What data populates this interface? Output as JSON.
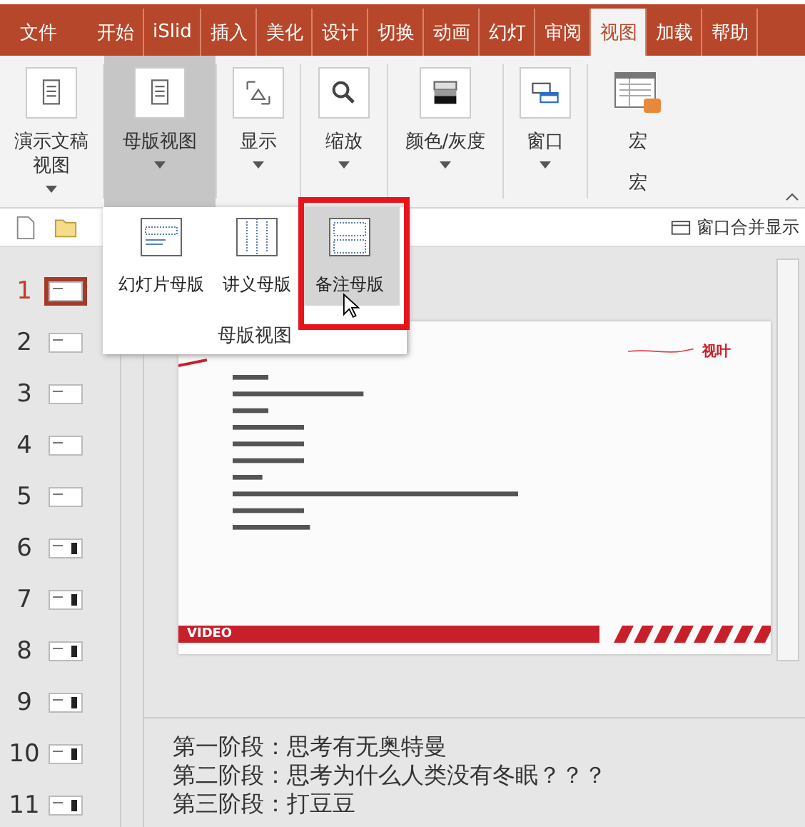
{
  "tabs": [
    {
      "label": "文件",
      "selected": false
    },
    {
      "label": "开始",
      "selected": false
    },
    {
      "label": "iSlid",
      "selected": false
    },
    {
      "label": "插入",
      "selected": false
    },
    {
      "label": "美化",
      "selected": false
    },
    {
      "label": "设计",
      "selected": false
    },
    {
      "label": "切换",
      "selected": false
    },
    {
      "label": "动画",
      "selected": false
    },
    {
      "label": "幻灯",
      "selected": false
    },
    {
      "label": "审阅",
      "selected": false
    },
    {
      "label": "视图",
      "selected": true
    },
    {
      "label": "加载",
      "selected": false
    },
    {
      "label": "帮助",
      "selected": false
    }
  ],
  "ribbon": {
    "buttons": [
      {
        "label": "演示文稿视图",
        "dropdown": true,
        "pressed": false
      },
      {
        "label": "母版视图",
        "dropdown": true,
        "pressed": true
      },
      {
        "label": "显示",
        "dropdown": true,
        "pressed": false
      },
      {
        "label": "缩放",
        "dropdown": true,
        "pressed": false
      },
      {
        "label": "颜色/灰度",
        "dropdown": true,
        "pressed": false
      },
      {
        "label": "窗口",
        "dropdown": true,
        "pressed": false
      },
      {
        "label": "宏",
        "dropdown": false,
        "pressed": false,
        "group_label": "宏"
      }
    ]
  },
  "toolbar": {
    "merge_window_label": "窗口合并显示"
  },
  "thumbnails": [
    {
      "number": "1",
      "selected": true
    },
    {
      "number": "2",
      "selected": false
    },
    {
      "number": "3",
      "selected": false
    },
    {
      "number": "4",
      "selected": false
    },
    {
      "number": "5",
      "selected": false
    },
    {
      "number": "6",
      "selected": false
    },
    {
      "number": "7",
      "selected": false
    },
    {
      "number": "8",
      "selected": false
    },
    {
      "number": "9",
      "selected": false
    },
    {
      "number": "10",
      "selected": false
    },
    {
      "number": "11",
      "selected": false
    }
  ],
  "popup": {
    "items": [
      {
        "label": "幻灯片母版",
        "selected": false
      },
      {
        "label": "讲义母版",
        "selected": false
      },
      {
        "label": "备注母版",
        "selected": true
      }
    ],
    "group_label": "母版视图"
  },
  "slide": {
    "logo": "视叶",
    "footer": "VIDEO"
  },
  "notes": [
    "第一阶段：思考有无奥特曼",
    "第二阶段：思考为什么人类没有冬眠？？？",
    "第三阶段：打豆豆"
  ]
}
